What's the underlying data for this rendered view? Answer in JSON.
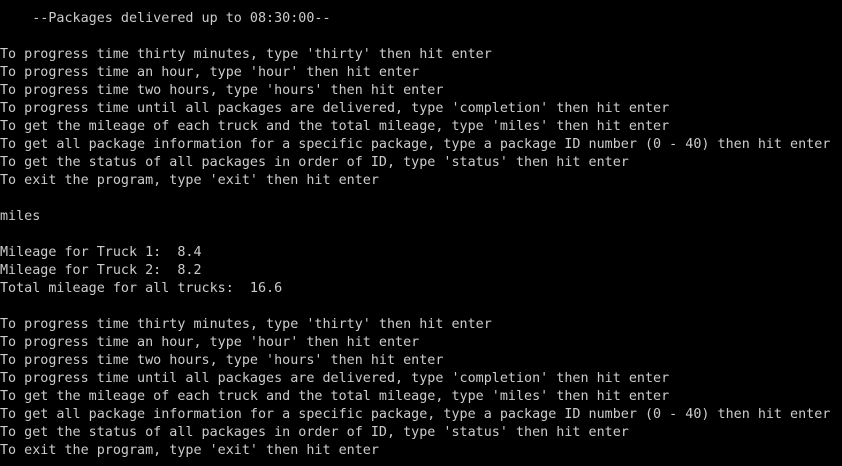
{
  "terminal": {
    "header": "    --Packages delivered up to 08:30:00--",
    "menu_block_1": [
      "To progress time thirty minutes, type 'thirty' then hit enter",
      "To progress time an hour, type 'hour' then hit enter",
      "To progress time two hours, type 'hours' then hit enter",
      "To progress time until all packages are delivered, type 'completion' then hit enter",
      "To get the mileage of each truck and the total mileage, type 'miles' then hit enter",
      "To get all package information for a specific package, type a package ID number (0 - 40) then hit enter",
      "To get the status of all packages in order of ID, type 'status' then hit enter",
      "To exit the program, type 'exit' then hit enter"
    ],
    "user_input": "miles",
    "mileage_output": [
      "Mileage for Truck 1:  8.4",
      "Mileage for Truck 2:  8.2",
      "Total mileage for all trucks:  16.6"
    ],
    "menu_block_2": [
      "To progress time thirty minutes, type 'thirty' then hit enter",
      "To progress time an hour, type 'hour' then hit enter",
      "To progress time two hours, type 'hours' then hit enter",
      "To progress time until all packages are delivered, type 'completion' then hit enter",
      "To get the mileage of each truck and the total mileage, type 'miles' then hit enter",
      "To get all package information for a specific package, type a package ID number (0 - 40) then hit enter",
      "To get the status of all packages in order of ID, type 'status' then hit enter",
      "To exit the program, type 'exit' then hit enter"
    ]
  }
}
